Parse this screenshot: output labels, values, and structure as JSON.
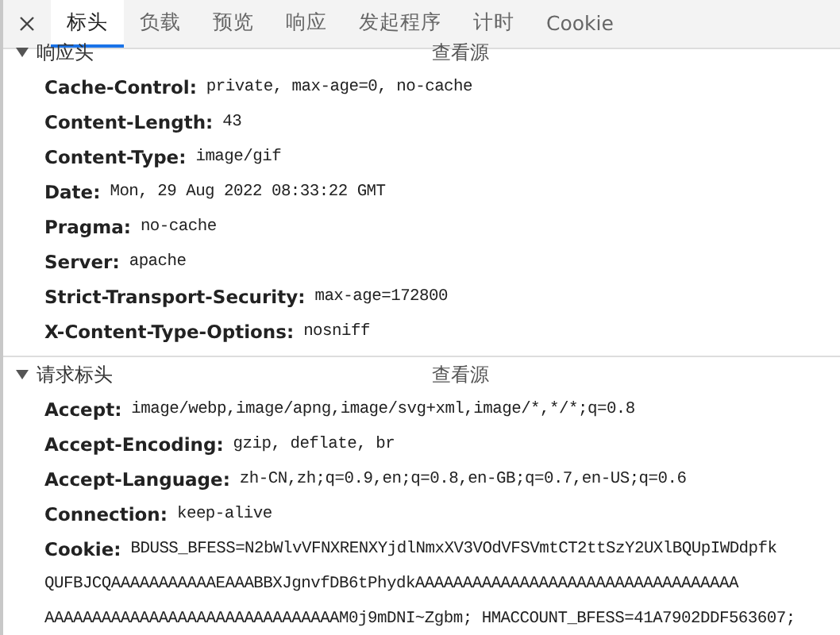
{
  "tabs": [
    {
      "label": "标头",
      "selected": true
    },
    {
      "label": "负载",
      "selected": false
    },
    {
      "label": "预览",
      "selected": false
    },
    {
      "label": "响应",
      "selected": false
    },
    {
      "label": "发起程序",
      "selected": false
    },
    {
      "label": "计时",
      "selected": false
    },
    {
      "label": "Cookie",
      "selected": false
    }
  ],
  "sections": [
    {
      "title": "响应头",
      "source_link": "查看源",
      "expanded": true,
      "headers": [
        {
          "name": "Cache-Control:",
          "value": "private, max-age=0, no-cache"
        },
        {
          "name": "Content-Length:",
          "value": "43"
        },
        {
          "name": "Content-Type:",
          "value": "image/gif"
        },
        {
          "name": "Date:",
          "value": "Mon, 29 Aug 2022 08:33:22 GMT"
        },
        {
          "name": "Pragma:",
          "value": "no-cache"
        },
        {
          "name": "Server:",
          "value": "apache"
        },
        {
          "name": "Strict-Transport-Security:",
          "value": "max-age=172800"
        },
        {
          "name": "X-Content-Type-Options:",
          "value": "nosniff"
        }
      ]
    },
    {
      "title": "请求标头",
      "source_link": "查看源",
      "expanded": true,
      "headers": [
        {
          "name": "Accept:",
          "value": "image/webp,image/apng,image/svg+xml,image/*,*/*;q=0.8"
        },
        {
          "name": "Accept-Encoding:",
          "value": "gzip, deflate, br"
        },
        {
          "name": "Accept-Language:",
          "value": "zh-CN,zh;q=0.9,en;q=0.8,en-GB;q=0.7,en-US;q=0.6"
        },
        {
          "name": "Connection:",
          "value": "keep-alive"
        },
        {
          "name": "Cookie:",
          "value": "BDUSS_BFESS=N2bWlvVFNXRENXYjdlNmxXV3VOdVFSVmtCT2ttSzY2UXlBQUpIWDdpfk",
          "continuation": [
            "QUFBJCQAAAAAAAAAAAEAAABBXJgnvfDB6tPhydkAAAAAAAAAAAAAAAAAAAAAAAAAAAAAAAAAA",
            "AAAAAAAAAAAAAAAAAAAAAAAAAAAAAAAM0j9mDNI~Zgbm; HMACCOUNT_BFESS=41A7902DDF563607;"
          ]
        }
      ]
    }
  ]
}
